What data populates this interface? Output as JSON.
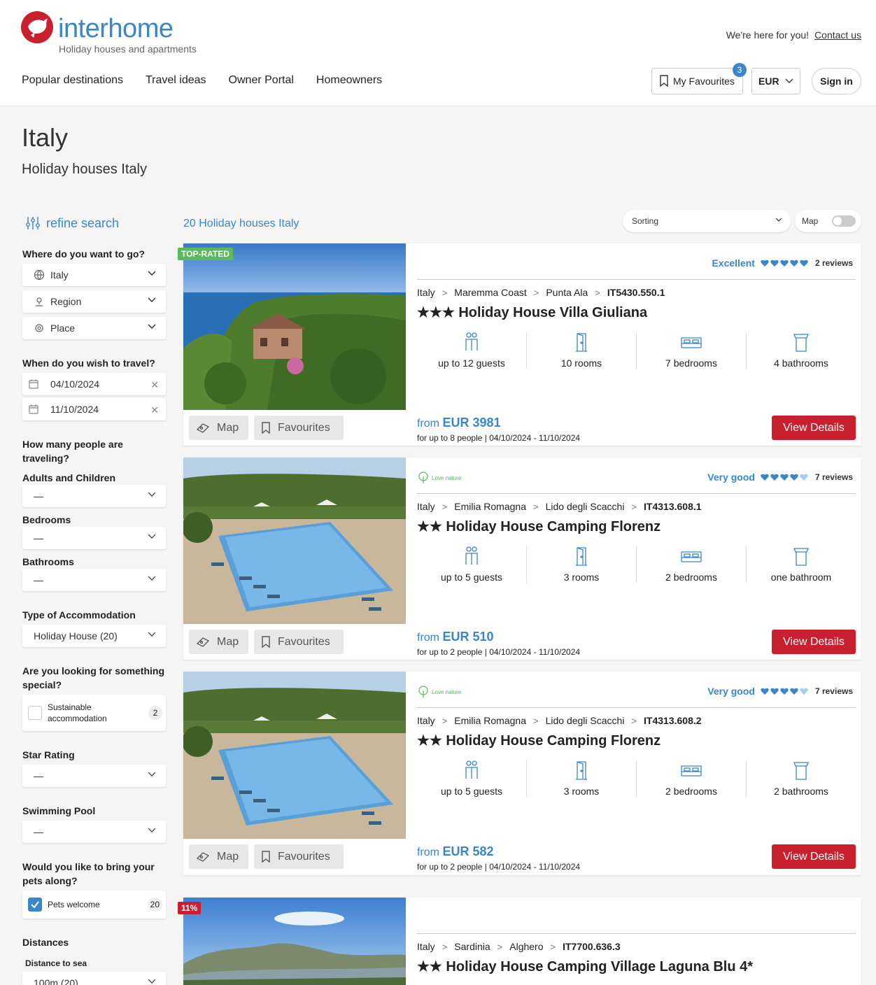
{
  "header": {
    "logo_text": "interhome",
    "logo_tagline": "Holiday houses and apartments",
    "help_text": "We're here for you!",
    "contact_link": "Contact us",
    "nav": [
      "Popular destinations",
      "Travel ideas",
      "Owner Portal",
      "Homeowners"
    ],
    "favourites_label": "My Favourites",
    "favourites_count": "3",
    "currency": "EUR",
    "sign_in": "Sign in"
  },
  "page": {
    "title": "Italy",
    "subtitle": "Holiday houses Italy"
  },
  "sidebar": {
    "refine": "refine search",
    "where_label": "Where do you want to go?",
    "country": "Italy",
    "region": "Region",
    "place": "Place",
    "when_label": "When do you wish to travel?",
    "date_from": "04/10/2024",
    "date_to": "11/10/2024",
    "people_label": "How many people are traveling?",
    "adults_label": "Adults and Children",
    "adults_value": "—",
    "bedrooms_label": "Bedrooms",
    "bedrooms_value": "—",
    "bathrooms_label": "Bathrooms",
    "bathrooms_value": "—",
    "type_label": "Type of Accommodation",
    "type_value": "Holiday House (20)",
    "special_label": "Are you looking for something special?",
    "sustainable_label": "Sustainable accommodation",
    "sustainable_count": "2",
    "star_label": "Star Rating",
    "star_value": "—",
    "pool_label": "Swimming Pool",
    "pool_value": "—",
    "pets_label": "Would you like to bring your pets along?",
    "pets_option": "Pets welcome",
    "pets_count": "20",
    "distances_label": "Distances",
    "sea_label": "Distance to sea",
    "sea_value": "100m (20)"
  },
  "results": {
    "count_text": "20 Holiday houses Italy",
    "sorting": "Sorting",
    "map_toggle": "Map",
    "map_button": "Map",
    "favourites_button": "Favourites",
    "view_details": "View Details",
    "love_nature": "Love nature",
    "listings": [
      {
        "badge": "TOP-RATED",
        "rating_label": "Excellent",
        "hearts_full": 5,
        "reviews": "2 reviews",
        "crumbs": [
          "Italy",
          "Maremma Coast",
          "Punta Ala"
        ],
        "code": "IT5430.550.1",
        "stars": "★★★",
        "title": "Holiday House Villa Giuliana",
        "guests": "up to 12 guests",
        "rooms": "10 rooms",
        "bedrooms": "7 bedrooms",
        "bathrooms": "4 bathrooms",
        "price_from": "from",
        "price": "EUR 3981",
        "price_note": "for up to 8 people | 04/10/2024 - 11/10/2024"
      },
      {
        "rating_label": "Very good",
        "hearts_full": 4,
        "reviews": "7 reviews",
        "crumbs": [
          "Italy",
          "Emilia Romagna",
          "Lido degli Scacchi"
        ],
        "code": "IT4313.608.1",
        "stars": "★★",
        "title": "Holiday House Camping Florenz",
        "guests": "up to 5 guests",
        "rooms": "3 rooms",
        "bedrooms": "2 bedrooms",
        "bathrooms": "one bathroom",
        "price_from": "from",
        "price": "EUR 510",
        "price_note": "for up to 2 people | 04/10/2024 - 11/10/2024"
      },
      {
        "rating_label": "Very good",
        "hearts_full": 4,
        "reviews": "7 reviews",
        "crumbs": [
          "Italy",
          "Emilia Romagna",
          "Lido degli Scacchi"
        ],
        "code": "IT4313.608.2",
        "stars": "★★",
        "title": "Holiday House Camping Florenz",
        "guests": "up to 5 guests",
        "rooms": "3 rooms",
        "bedrooms": "2 bedrooms",
        "bathrooms": "2 bathrooms",
        "price_from": "from",
        "price": "EUR 582",
        "price_note": "for up to 2 people | 04/10/2024 - 11/10/2024"
      },
      {
        "badge": "11%",
        "crumbs": [
          "Italy",
          "Sardinia",
          "Alghero"
        ],
        "code": "IT7700.636.3",
        "stars": "★★",
        "title": "Holiday House Camping Village Laguna Blu 4*"
      }
    ]
  },
  "colors": {
    "brand_red": "#c8202f",
    "brand_blue": "#3a86c8",
    "green": "#5cb85c"
  }
}
